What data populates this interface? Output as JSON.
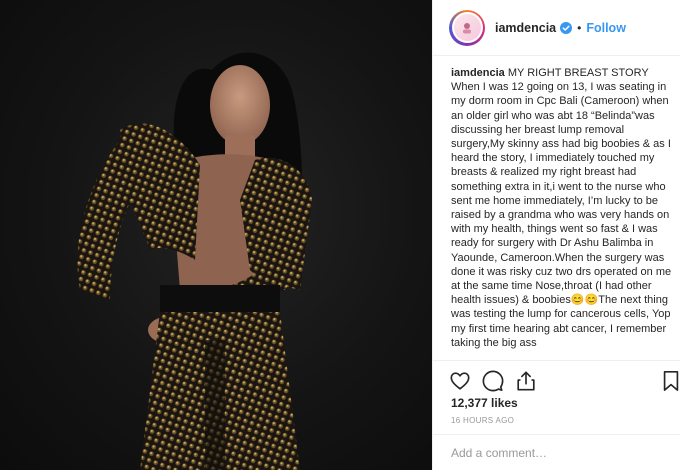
{
  "post": {
    "username": "iamdencia",
    "separator": "•",
    "follow_label": "Follow",
    "caption_user": "iamdencia",
    "caption_text": "MY RIGHT BREAST STORY When I was 12 going on 13, I was seating in my dorm room in Cpc Bali (Cameroon) when an older girl who was abt 18 “Belinda”was discussing her breast lump removal surgery,My skinny ass had big boobies & as I heard the story, I immediately touched my breasts & realized my right breast had something extra in it,i went to the nurse who sent me home immediately, I’m lucky to be raised by a grandma who was very hands on with my health, things went so fast & I was ready for surgery with Dr Ashu Balimba in Yaounde, Cameroon.When the surgery was done it was risky cuz two drs operated on me at the same time Nose,throat (I had other health issues) & boobies😊😊The next thing was testing the lump for cancerous cells, Yop my first time hearing abt cancer, I remember taking the big ass",
    "likes": "12,377 likes",
    "time": "16 HOURS AGO",
    "comment_placeholder": "Add a comment…"
  },
  "icons": {
    "avatar": "profile-avatar",
    "verified": "verified-badge-icon",
    "like": "heart-icon",
    "comment": "comment-bubble-icon",
    "share": "share-arrow-icon",
    "save": "bookmark-icon"
  },
  "colors": {
    "accent": "#3897f0",
    "text": "#262626",
    "muted": "#999999",
    "border": "#efefef",
    "photo_background": "#141414"
  }
}
